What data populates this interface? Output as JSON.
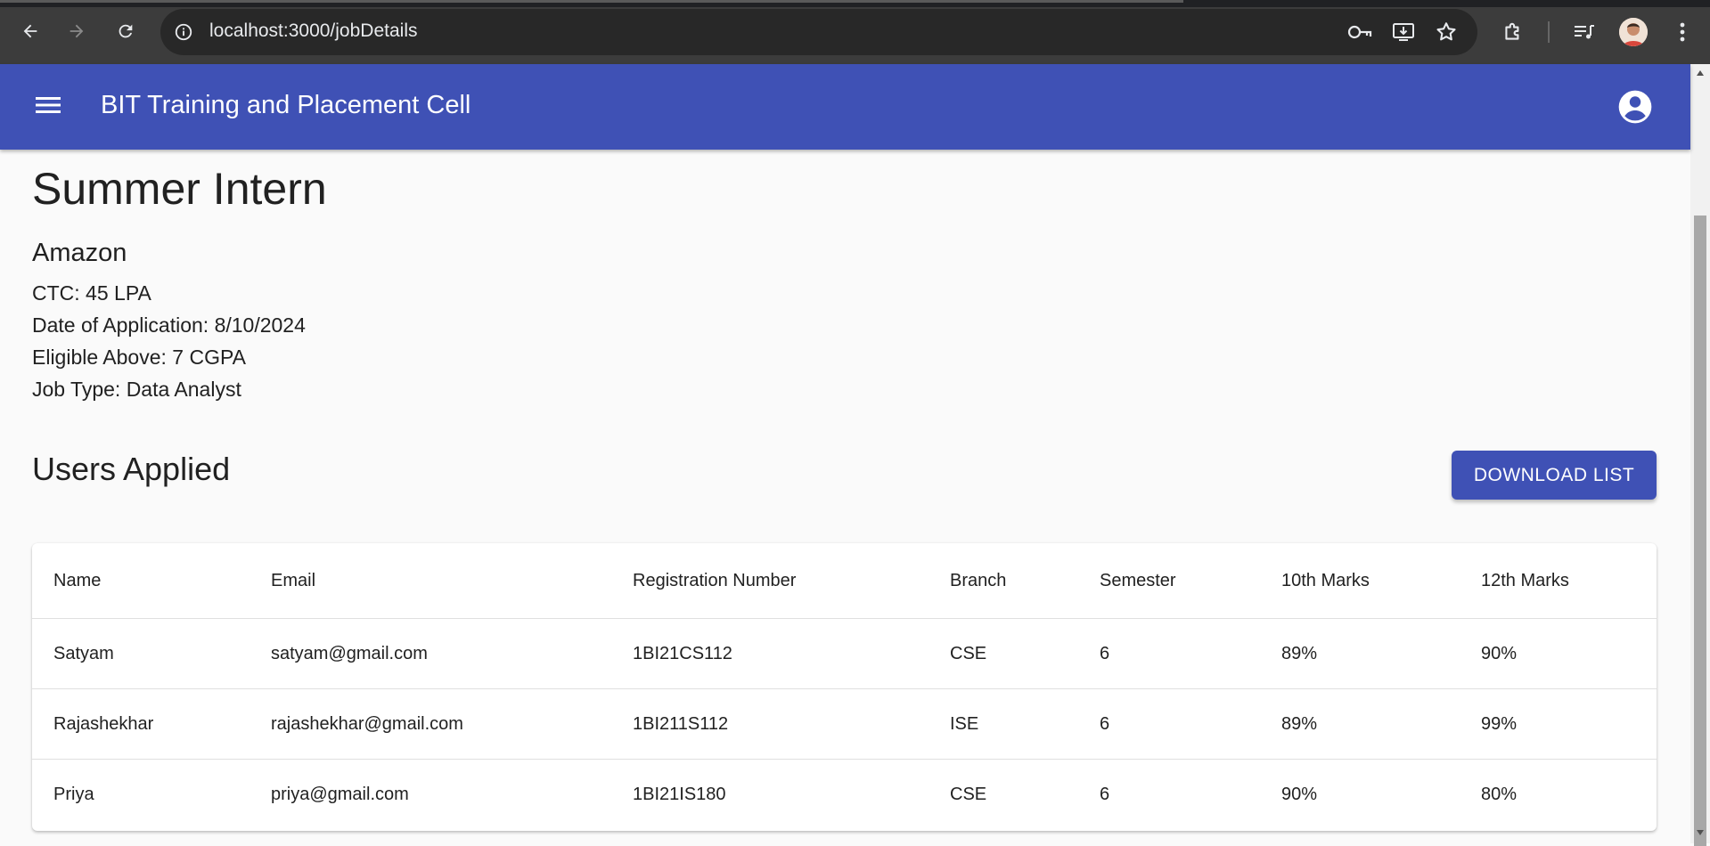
{
  "browser": {
    "url": "localhost:3000/jobDetails"
  },
  "appbar": {
    "title": "BIT Training and Placement Cell"
  },
  "job": {
    "title": "Summer Intern",
    "company": "Amazon",
    "ctc": "CTC: 45 LPA",
    "date": "Date of Application: 8/10/2024",
    "eligibility": "Eligible Above: 7 CGPA",
    "job_type": "Job Type: Data Analyst"
  },
  "applicants": {
    "section_title": "Users Applied",
    "download_label": "Download List",
    "columns": [
      "Name",
      "Email",
      "Registration Number",
      "Branch",
      "Semester",
      "10th Marks",
      "12th Marks"
    ],
    "rows": [
      [
        "Satyam",
        "satyam@gmail.com",
        "1BI21CS112",
        "CSE",
        "6",
        "89%",
        "90%"
      ],
      [
        "Rajashekhar",
        "rajashekhar@gmail.com",
        "1BI211S112",
        "ISE",
        "6",
        "89%",
        "99%"
      ],
      [
        "Priya",
        "priya@gmail.com",
        "1BI21IS180",
        "CSE",
        "6",
        "90%",
        "80%"
      ]
    ]
  },
  "colors": {
    "primary": "#3f51b5",
    "chrome_bg": "#3c3c3c",
    "omnibox_bg": "#282828"
  },
  "icons": [
    "back-arrow-icon",
    "forward-arrow-icon",
    "reload-icon",
    "site-info-icon",
    "password-key-icon",
    "install-app-icon",
    "bookmark-star-icon",
    "extensions-icon",
    "media-controls-icon",
    "kebab-menu-icon",
    "hamburger-menu-icon",
    "account-circle-icon"
  ]
}
